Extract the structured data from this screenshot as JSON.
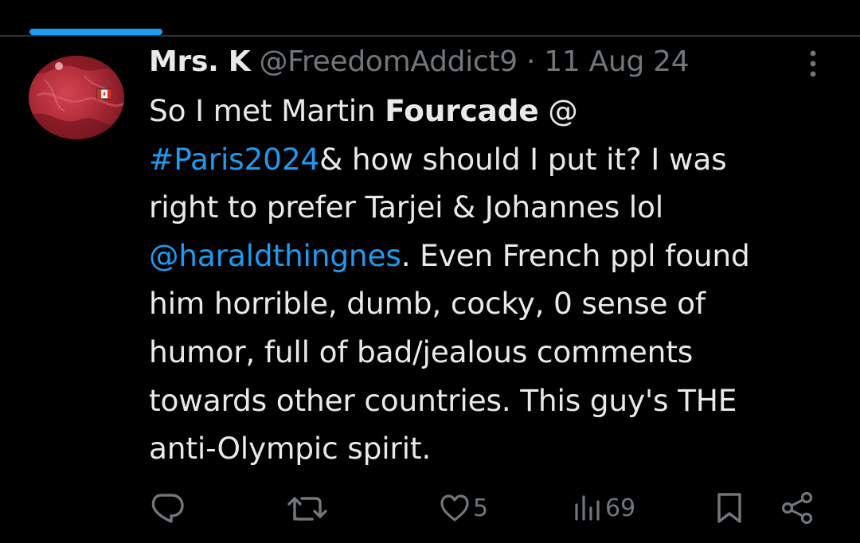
{
  "tweet": {
    "author_name": "Mrs. K",
    "author_handle": "@FreedomAddict9",
    "separator": "·",
    "date": "11 Aug 24",
    "lines": {
      "l1": {
        "a": "So I met Martin ",
        "b": "Fourcade",
        "c": " @"
      },
      "l2": {
        "a": "#Paris2024",
        "b": "& how should I put it? I was"
      },
      "l3": {
        "a": "right to prefer Tarjei & Johannes lol"
      },
      "l4": {
        "a": "@haraldthingnes",
        "b": ". Even French ppl found"
      },
      "l5": {
        "a": "him horrible, dumb, cocky, 0 sense of"
      },
      "l6": {
        "a": "humor, full of bad/jealous comments"
      },
      "l7": {
        "a": "towards other countries. This guy's THE"
      },
      "l8": {
        "a": "anti-Olympic spirit."
      }
    }
  },
  "actions": {
    "reply_icon": "reply-icon",
    "retweet_icon": "retweet-icon",
    "like_icon": "heart-icon",
    "like_count": "5",
    "views_icon": "views-icon",
    "views_count": "69",
    "bookmark_icon": "bookmark-icon",
    "share_icon": "share-icon"
  },
  "colors": {
    "background": "#000000",
    "text": "#e7e9ea",
    "muted": "#71767b",
    "link": "#1d9bf0",
    "divider": "#2f3336"
  }
}
